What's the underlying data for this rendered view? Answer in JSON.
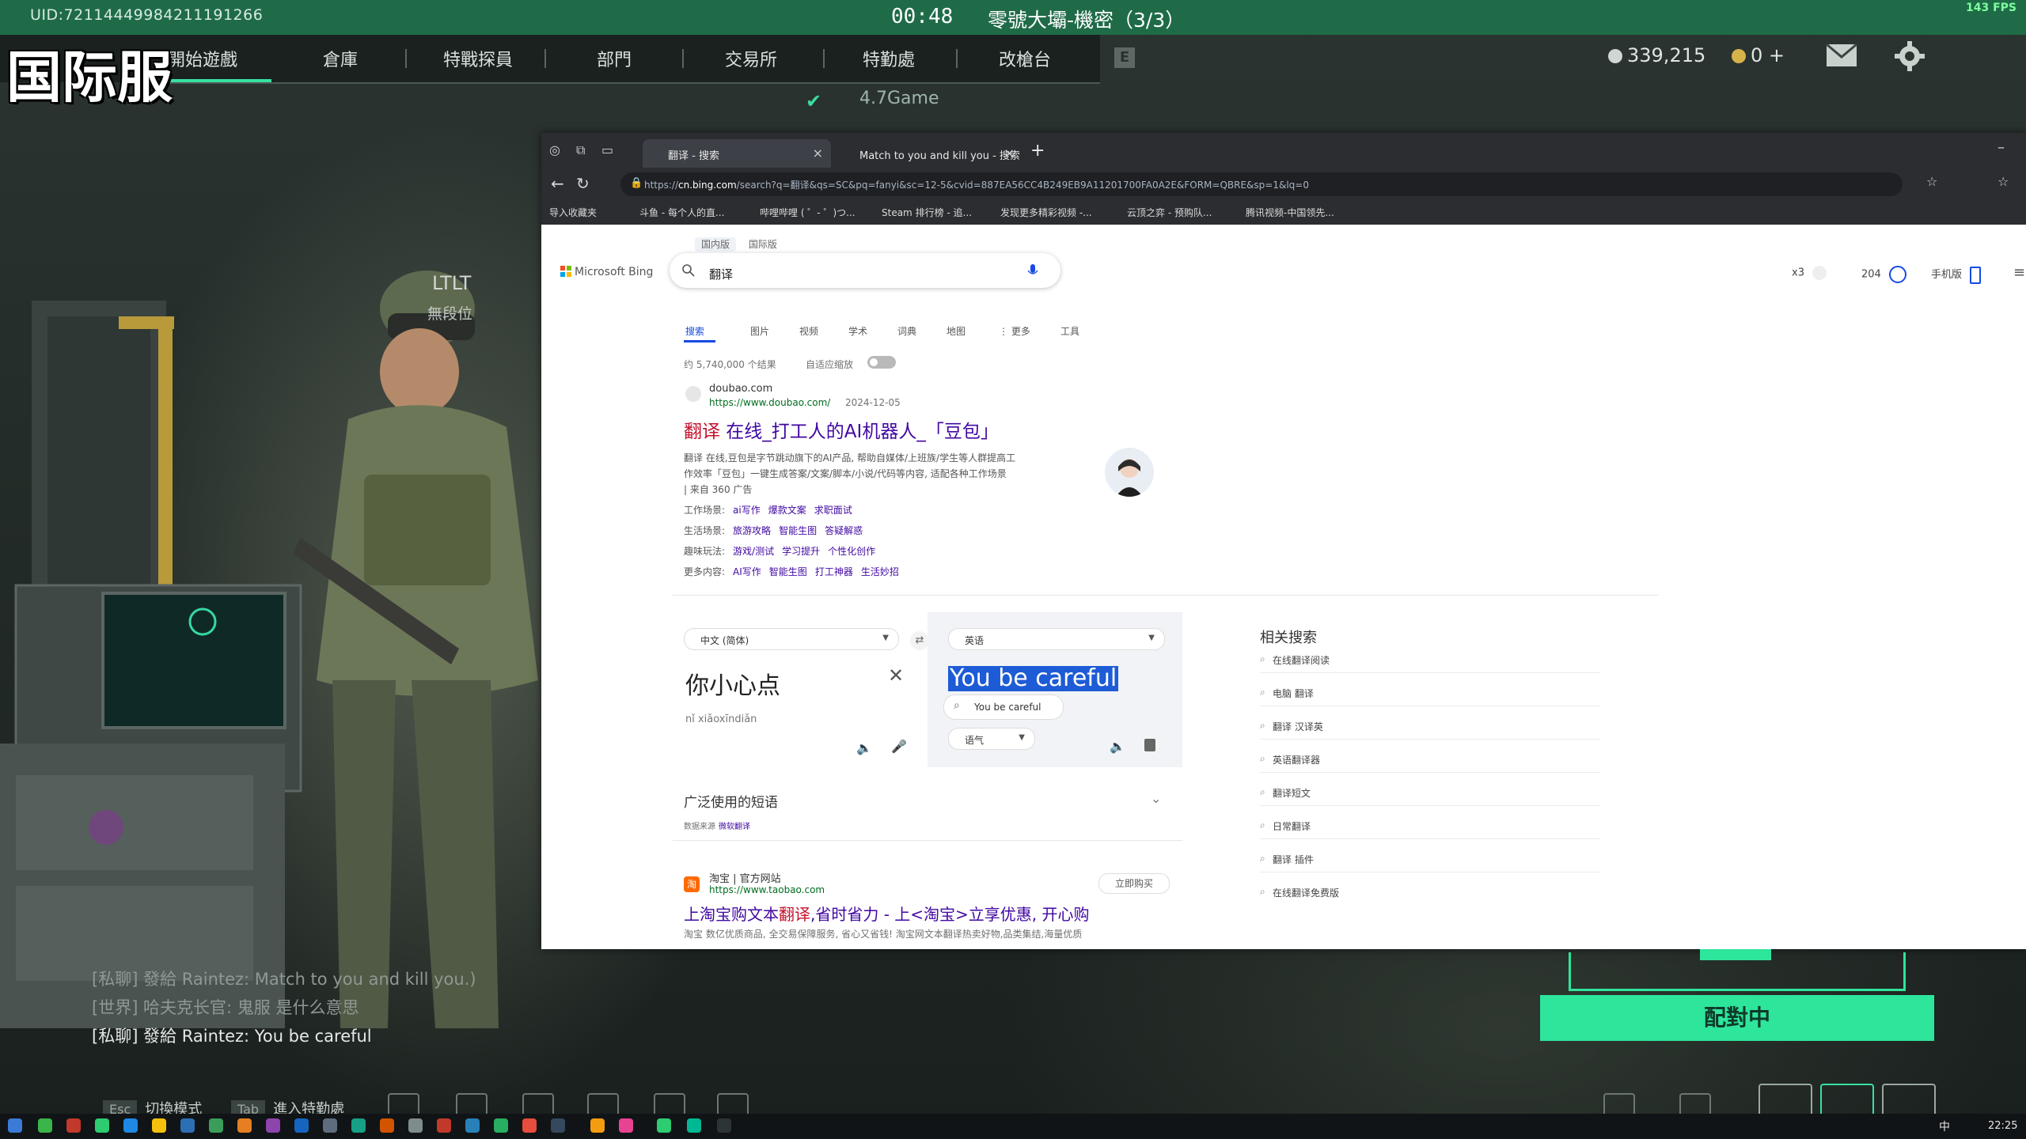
{
  "game": {
    "uid": "UID:72114449984211191266",
    "timer": "00:48",
    "mode_title": "零號大壩-機密（3/3）",
    "fps": "143 FPS",
    "overlay_label": "国际服",
    "menu": [
      "開始遊戲",
      "倉庫",
      "特戰探員",
      "部門",
      "交易所",
      "特勤處",
      "改槍台"
    ],
    "menu_hotkey": "E",
    "currency_primary": "339,215",
    "currency_secondary": "0 +",
    "gamer_tag": "4.7Game",
    "squad_tag": "LTLT",
    "squad_sub": "無段位",
    "chat": [
      {
        "text": "[私聊] 發給 Raintez: Match to you and kill you.)",
        "color": "#8e9894"
      },
      {
        "text": "[世界] 哈夫克长官: 鬼服 是什么意思",
        "color": "#8e9894"
      },
      {
        "text": "[私聊] 發給 Raintez: You be careful",
        "color": "#e4e9e6"
      }
    ],
    "matching_label": "配對中",
    "hints": [
      {
        "key": "Esc",
        "label": "切換模式"
      },
      {
        "key": "Tab",
        "label": "進入特勤處"
      }
    ]
  },
  "browser": {
    "tabs": [
      {
        "title": "翻译 - 搜索"
      },
      {
        "title": "Match to you and kill you - 搜索"
      }
    ],
    "url_prefix": "https://",
    "url_host": "cn.bing.com",
    "url_rest": "/search?q=翻译&qs=SC&pq=fanyi&sc=12-5&cvid=887EA56CC4B249EB9A11201700FA0A2E&FORM=QBRE&sp=1&lq=0",
    "bookmarks": [
      "导入收藏夹",
      "斗鱼 - 每个人的直...",
      "哔哩哔哩 ( ゜- ゜)つ...",
      "Steam 排行榜 - 追...",
      "发现更多精彩视频 -...",
      "云顶之弈 - 预购队...",
      "腾讯视频-中国领先..."
    ]
  },
  "bing": {
    "region_tabs": [
      "国内版",
      "国际版"
    ],
    "logo": "Microsoft Bing",
    "query": "翻译",
    "rewards": "x3",
    "points": "204",
    "mobile": "手机版",
    "scopes": [
      "搜索",
      "图片",
      "视频",
      "学术",
      "词典",
      "地图",
      "⋮ 更多",
      "工具"
    ],
    "result_count": "约 5,740,000 个结果",
    "autozoom": "自适应缩放",
    "result1": {
      "site": "doubao.com",
      "url": "https://www.doubao.com/",
      "date": "2024-12-05",
      "title_hl": "翻译",
      "title_rest": " 在线_打工人的AI机器人_「豆包」",
      "lines": [
        "翻译 在线,豆包是字节跳动旗下的AI产品, 帮助自媒体/上班族/学生等人群提高工",
        "作效率「豆包」一键生成答案/文案/脚本/小说/代码等内容, 适配各种工作场景",
        "| 来自 360 广告"
      ],
      "sitelinks": [
        {
          "label": "工作场景:",
          "links": [
            "ai写作",
            "爆款文案",
            "求职面试"
          ]
        },
        {
          "label": "生活场景:",
          "links": [
            "旅游攻略",
            "智能生图",
            "答疑解惑"
          ]
        },
        {
          "label": "趣味玩法:",
          "links": [
            "游戏/测试",
            "学习提升",
            "个性化创作"
          ]
        },
        {
          "label": "更多内容:",
          "links": [
            "AI写作",
            "智能生图",
            "打工神器",
            "生活妙招"
          ]
        }
      ]
    },
    "translator": {
      "source_lang": "中文 (简体)",
      "target_lang": "英语",
      "source_text": "你小心点",
      "pinyin": "nǐ xiǎoxīndiǎn",
      "target_text": "You be careful",
      "suggestion": "You be careful",
      "tone": "语气",
      "phrases_title": "广泛使用的短语",
      "phrases_prefix": "数据来源",
      "phrases_link": "微软翻译"
    },
    "result2": {
      "site": "淘宝 | 官方网站",
      "url": "https://www.taobao.com",
      "buy": "立即购买",
      "title_pre": "上淘宝购文本",
      "title_hl": "翻译",
      "title_rest": ",省时省力 - 上<淘宝>立享优惠, 开心购",
      "desc": "淘宝 数亿优质商品, 全交易保障服务, 省心又省钱! 淘宝网文本翻译热卖好物,品类集结,海量优质"
    },
    "related_title": "相关搜索",
    "related": [
      "在线翻译阅读",
      "电脑 翻译",
      "翻译 汉译英",
      "英语翻译器",
      "翻译短文",
      "日常翻译",
      "翻译 插件",
      "在线翻译免费版"
    ]
  },
  "taskbar": {
    "ime": "中",
    "clock": "22:25"
  }
}
